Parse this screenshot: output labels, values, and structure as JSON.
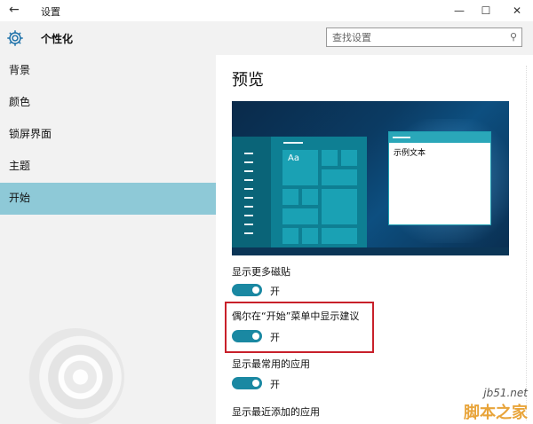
{
  "window": {
    "back_glyph": "←",
    "title": "设置",
    "minimize_glyph": "—",
    "maximize_glyph": "☐",
    "close_glyph": "✕"
  },
  "header": {
    "section_title": "个性化",
    "search_placeholder": "查找设置",
    "search_icon_glyph": "⚲",
    "gear_icon": "gear-icon"
  },
  "sidebar": {
    "items": [
      {
        "label": "背景",
        "active": false
      },
      {
        "label": "颜色",
        "active": false
      },
      {
        "label": "锁屏界面",
        "active": false
      },
      {
        "label": "主题",
        "active": false
      },
      {
        "label": "开始",
        "active": true
      }
    ]
  },
  "main": {
    "heading": "预览",
    "preview": {
      "tile_label": "Aa",
      "sample_window_text": "示例文本"
    },
    "settings": [
      {
        "label": "显示更多磁贴",
        "state": "开",
        "on": true
      },
      {
        "label": "偶尔在“开始”菜单中显示建议",
        "state": "开",
        "on": true
      },
      {
        "label": "显示最常用的应用",
        "state": "开",
        "on": true
      },
      {
        "label": "显示最近添加的应用",
        "state": "",
        "on": null
      }
    ]
  },
  "watermark": {
    "site": "jb51.net",
    "brand": "脚本之家"
  },
  "colors": {
    "accent": "#1a88a2",
    "active_nav": "#8ec9d7",
    "highlight_border": "#c8202a"
  }
}
